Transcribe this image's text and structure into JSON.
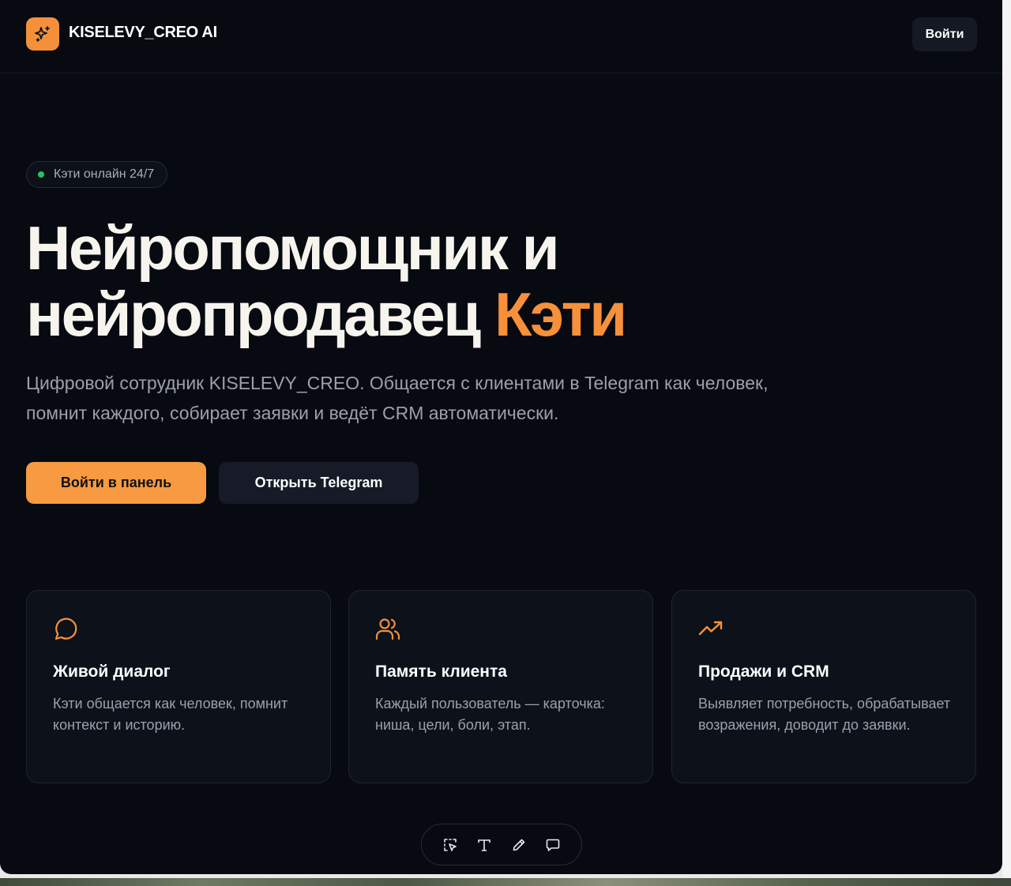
{
  "header": {
    "brand": "KISELEVY_CREO AI",
    "login_label": "Войти"
  },
  "badge": {
    "text": "Кэти онлайн 24/7",
    "dot_color": "#22c55e"
  },
  "hero": {
    "title_line1": "Нейропомощник и",
    "title_line2_prefix": "нейропродавец",
    "title_accent": "Кэти",
    "subtitle": "Цифровой сотрудник KISELEVY_CREO. Общается с клиентами в Telegram как человек, помнит каждого, собирает заявки и ведёт CRM автоматически."
  },
  "actions": {
    "primary_label": "Войти в панель",
    "secondary_label": "Открыть Telegram"
  },
  "features": [
    {
      "icon": "chat-bubble-icon",
      "title": "Живой диалог",
      "text": "Кэти общается как человек, помнит контекст и историю."
    },
    {
      "icon": "users-icon",
      "title": "Память клиента",
      "text": "Каждый пользователь — карточка: ниша, цели, боли, этап."
    },
    {
      "icon": "trending-up-icon",
      "title": "Продажи и CRM",
      "text": "Выявляет потребность, обрабатывает возражения, доводит до заявки."
    }
  ],
  "toolbar": {
    "tools": [
      "select-icon",
      "text-icon",
      "pencil-icon",
      "comment-icon"
    ]
  },
  "colors": {
    "accent": "#f7903a",
    "background": "#070a11",
    "card_background": "#0c111a",
    "muted_text": "#9ca0aa"
  }
}
